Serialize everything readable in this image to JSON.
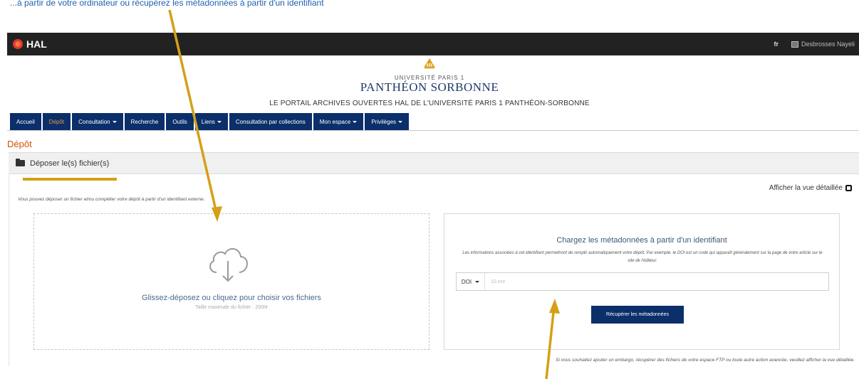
{
  "caption": {
    "text": "...à partir de votre ordinateur ou récupérez les métadonnées à partir d'un identifiant"
  },
  "topbar": {
    "app_name": "HAL",
    "lang": "fr",
    "user": "Desbrosses Nayeli"
  },
  "brand": {
    "university_small": "UNIVERSITÉ PARIS 1",
    "university_big": "PANTHÉON SORBONNE",
    "portal_title": "LE PORTAIL ARCHIVES OUVERTES HAL DE L'UNIVERSITÉ PARIS 1 PANTHÉON-SORBONNE"
  },
  "nav": {
    "items": [
      {
        "label": "Accueil"
      },
      {
        "label": "Dépôt"
      },
      {
        "label": "Consultation"
      },
      {
        "label": "Recherche"
      },
      {
        "label": "Outils"
      },
      {
        "label": "Liens"
      },
      {
        "label": "Consultation par collections"
      },
      {
        "label": "Mon espace"
      },
      {
        "label": "Privilèges"
      }
    ]
  },
  "page": {
    "title": "Dépôt",
    "section_title": "Déposer le(s) fichier(s)",
    "detail_view_label": "Afficher la vue détaillée",
    "intro": "Vous pouvez déposer un fichier et/ou compléter votre dépôt à partir d'un identifiant externe."
  },
  "dropzone": {
    "label": "Glissez-déposez ou cliquez pour choisir vos fichiers",
    "max_size": "Taille maximale du fichier : 200M"
  },
  "metadata": {
    "title": "Chargez les métadonnées à partir d'un identifiant",
    "description": "Les informations associées à cet identifiant permettront de remplir automatiquement votre dépôt. Par exemple, le DOI est un code qui apparaît généralement sur la page de votre article sur le site de l'éditeur.",
    "id_type": "DOI",
    "placeholder": "10.xxx",
    "button": "Récupérer les métadonnées"
  },
  "footer": {
    "note": "Si vous souhaitez ajouter un embargo, récupérer des fichiers de votre espace FTP ou toute autre action avancée, veuillez afficher la vue détaillée."
  },
  "colors": {
    "nav_bg": "#0b2f6a",
    "active_nav": "#e79642",
    "title_orange": "#d35400",
    "annotation_gold": "#d4a017"
  }
}
